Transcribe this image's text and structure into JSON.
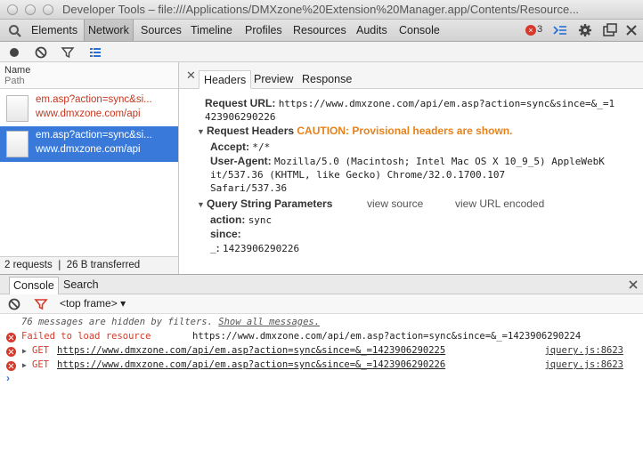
{
  "window": {
    "title": "Developer Tools – file:///Applications/DMXzone%20Extension%20Manager.app/Contents/Resource..."
  },
  "toolbar": {
    "tabs": [
      {
        "label": "Elements"
      },
      {
        "label": "Network"
      },
      {
        "label": "Sources"
      },
      {
        "label": "Timeline"
      },
      {
        "label": "Profiles"
      },
      {
        "label": "Resources"
      },
      {
        "label": "Audits"
      },
      {
        "label": "Console"
      }
    ],
    "active_tab": "Network",
    "error_count": "3"
  },
  "network": {
    "columns": {
      "name": "Name",
      "path": "Path"
    },
    "requests": [
      {
        "name": "em.asp?action=sync&si...",
        "path": "www.dmxzone.com/api",
        "status": "failed"
      },
      {
        "name": "em.asp?action=sync&si...",
        "path": "www.dmxzone.com/api",
        "status": "selected"
      }
    ],
    "summary": "2 requests ❘ 26 B transferred"
  },
  "details": {
    "tabs": [
      {
        "label": "Headers"
      },
      {
        "label": "Preview"
      },
      {
        "label": "Response"
      }
    ],
    "request_url_label": "Request URL:",
    "request_url_line1": "https://www.dmxzone.com/api/em.asp?action=sync&since=&_=1",
    "request_url_line2": "423906290226",
    "request_headers_label": "Request Headers",
    "caution": "CAUTION: Provisional headers are shown.",
    "accept_label": "Accept:",
    "accept_value": "*/*",
    "user_agent_label": "User-Agent:",
    "user_agent_line1": "Mozilla/5.0 (Macintosh; Intel Mac OS X 10_9_5) AppleWebK",
    "user_agent_line2": "it/537.36 (KHTML, like Gecko) Chrome/32.0.1700.107",
    "user_agent_line3": "Safari/537.36",
    "query_label": "Query String Parameters",
    "view_source": "view source",
    "view_url_encoded": "view URL encoded",
    "params": [
      {
        "key": "action:",
        "value": "sync"
      },
      {
        "key": "since:",
        "value": ""
      },
      {
        "key": "_:",
        "value": "1423906290226"
      }
    ]
  },
  "drawer": {
    "tabs": [
      {
        "label": "Console"
      },
      {
        "label": "Search"
      }
    ],
    "frame": "<top frame>"
  },
  "console": {
    "hidden": "76 messages are hidden by filters.",
    "show_all": "Show all messages.",
    "messages": [
      {
        "text": "Failed to load resource",
        "url": "https://www.dmxzone.com/api/em.asp?action=sync&since=&_=1423906290224",
        "source": ""
      },
      {
        "method": "GET",
        "url": "https://www.dmxzone.com/api/em.asp?action=sync&since=&_=1423906290225",
        "source": "jquery.js:8623"
      },
      {
        "method": "GET",
        "url": "https://www.dmxzone.com/api/em.asp?action=sync&since=&_=1423906290226",
        "source": "jquery.js:8623"
      }
    ],
    "prompt": "›"
  },
  "colors": {
    "selection": "#3879d9",
    "error": "#d43a27",
    "caution": "#e7811a"
  }
}
